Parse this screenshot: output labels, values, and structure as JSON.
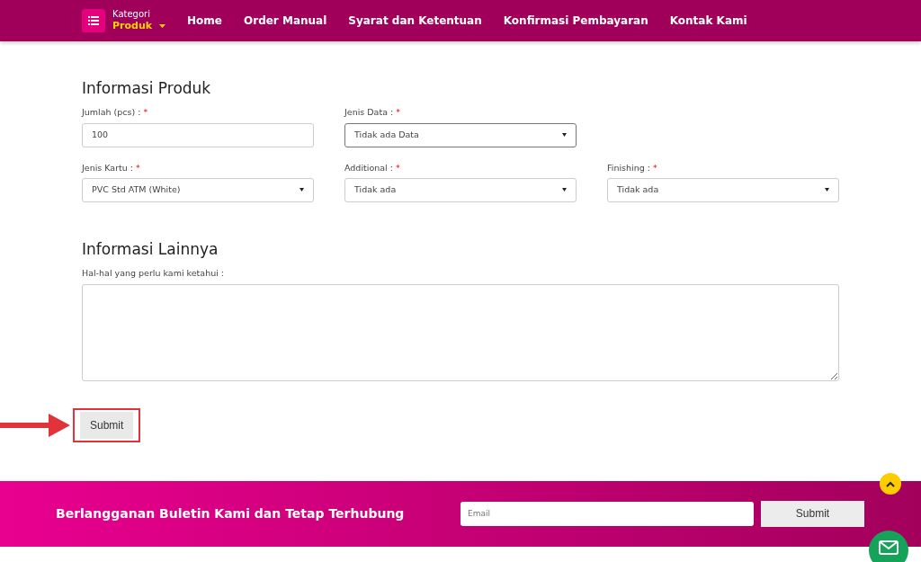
{
  "navbar": {
    "category_label": "Kategori",
    "category_value": "Produk",
    "links": [
      "Home",
      "Order Manual",
      "Syarat dan Ketentuan",
      "Konfirmasi Pembayaran",
      "Kontak Kami"
    ]
  },
  "sections": [
    {
      "title": "Informasi Produk",
      "rows": [
        [
          {
            "kind": "input",
            "label": "Jumlah (pcs) :",
            "required_mark": "*",
            "value": "100"
          },
          {
            "kind": "select",
            "label": "Jenis Data :",
            "required_mark": "*",
            "value": "Tidak ada Data",
            "focused": true
          }
        ],
        [
          {
            "kind": "select",
            "label": "Jenis Kartu :",
            "required_mark": "*",
            "value": "PVC Std ATM (White)",
            "focused": false
          },
          {
            "kind": "select",
            "label": "Additional :",
            "required_mark": "*",
            "value": "Tidak ada",
            "focused": false
          },
          {
            "kind": "select",
            "label": "Finishing :",
            "required_mark": "*",
            "value": "Tidak ada",
            "focused": false
          }
        ]
      ]
    },
    {
      "title": "Informasi Lainnya",
      "rows": [
        [
          {
            "kind": "textarea",
            "label": "Hal-hal yang perlu kami ketahui :"
          }
        ]
      ]
    }
  ],
  "submit": {
    "label": "Submit",
    "highlighted": true
  },
  "footer": {
    "text": "Berlangganan Buletin Kami dan Tetap Terhubung",
    "email_placeholder": "Email",
    "button": "Submit"
  }
}
